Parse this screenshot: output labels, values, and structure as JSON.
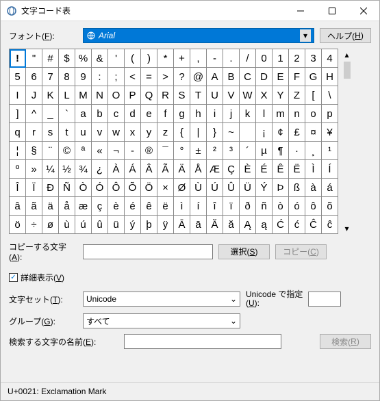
{
  "window": {
    "title": "文字コード表"
  },
  "font_row": {
    "label_pre": "フォント(",
    "label_key": "F",
    "label_post": "):",
    "selected": "Arial"
  },
  "help_btn": {
    "pre": "ヘルプ(",
    "key": "H",
    "post": ")"
  },
  "chars": [
    "!",
    "\"",
    "#",
    "$",
    "%",
    "&",
    "'",
    "(",
    ")",
    "*",
    "+",
    ",",
    "-",
    ".",
    "/",
    "0",
    "1",
    "2",
    "3",
    "4",
    "5",
    "6",
    "7",
    "8",
    "9",
    ":",
    ";",
    "<",
    "=",
    ">",
    "?",
    "@",
    "A",
    "B",
    "C",
    "D",
    "E",
    "F",
    "G",
    "H",
    "I",
    "J",
    "K",
    "L",
    "M",
    "N",
    "O",
    "P",
    "Q",
    "R",
    "S",
    "T",
    "U",
    "V",
    "W",
    "X",
    "Y",
    "Z",
    "[",
    "\\",
    "]",
    "^",
    "_",
    "`",
    "a",
    "b",
    "c",
    "d",
    "e",
    "f",
    "g",
    "h",
    "i",
    "j",
    "k",
    "l",
    "m",
    "n",
    "o",
    "p",
    "q",
    "r",
    "s",
    "t",
    "u",
    "v",
    "w",
    "x",
    "y",
    "z",
    "{",
    "|",
    "}",
    "~",
    "",
    "¡",
    "¢",
    "£",
    "¤",
    "¥",
    "¦",
    "§",
    "¨",
    "©",
    "ª",
    "«",
    "¬",
    "-",
    "®",
    "¯",
    "°",
    "±",
    "²",
    "³",
    "´",
    "µ",
    "¶",
    "·",
    "¸",
    "¹",
    "º",
    "»",
    "¼",
    "½",
    "¾",
    "¿",
    "À",
    "Á",
    "Â",
    "Ã",
    "Ä",
    "Å",
    "Æ",
    "Ç",
    "È",
    "É",
    "Ê",
    "Ë",
    "Ì",
    "Í",
    "Î",
    "Ï",
    "Ð",
    "Ñ",
    "Ò",
    "Ó",
    "Ô",
    "Õ",
    "Ö",
    "×",
    "Ø",
    "Ù",
    "Ú",
    "Û",
    "Ü",
    "Ý",
    "Þ",
    "ß",
    "à",
    "á",
    "â",
    "ã",
    "ä",
    "å",
    "æ",
    "ç",
    "è",
    "é",
    "ê",
    "ë",
    "ì",
    "í",
    "î",
    "ï",
    "ð",
    "ñ",
    "ò",
    "ó",
    "ô",
    "õ",
    "ö",
    "÷",
    "ø",
    "ù",
    "ú",
    "û",
    "ü",
    "ý",
    "þ",
    "ÿ",
    "Ā",
    "ā",
    "Ă",
    "ă",
    "Ą",
    "ą",
    "Ć",
    "ć",
    "Ĉ",
    "ĉ"
  ],
  "selected_index": 0,
  "copy_row": {
    "label_pre": "コピーする文字(",
    "label_key": "A",
    "label_post": "):",
    "value": ""
  },
  "select_btn": {
    "pre": "選択(",
    "key": "S",
    "post": ")"
  },
  "copy_btn": {
    "pre": "コピー(",
    "key": "C",
    "post": ")"
  },
  "advanced_chk": {
    "pre": "詳細表示(",
    "key": "V",
    "post": ")",
    "checked": true
  },
  "charset_row": {
    "label_pre": "文字セット(",
    "label_key": "T",
    "label_post": "):",
    "selected": "Unicode"
  },
  "goto": {
    "label_pre": "Unicode で指定\n(",
    "key": "U",
    "label_post": "):"
  },
  "group_row": {
    "label_pre": "グループ(",
    "label_key": "G",
    "label_post": "):",
    "selected": "すべて"
  },
  "search_row": {
    "label_pre": "検索する文字の名前(",
    "label_key": "E",
    "label_post": "):",
    "value": ""
  },
  "search_btn": {
    "pre": "検索(",
    "key": "R",
    "post": ")"
  },
  "status": {
    "text": "U+0021: Exclamation Mark"
  }
}
